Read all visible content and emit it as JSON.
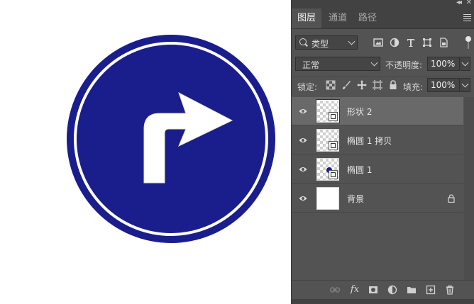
{
  "panel": {
    "tabs": [
      {
        "label": "图层",
        "active": true
      },
      {
        "label": "通道",
        "active": false
      },
      {
        "label": "路径",
        "active": false
      }
    ],
    "filter": {
      "kind_label": "类型"
    },
    "blend_mode": "正常",
    "opacity_label": "不透明度:",
    "opacity_value": "100%",
    "lock_label": "锁定:",
    "fill_label": "填充:",
    "fill_value": "100%",
    "layers": [
      {
        "name": "形状 2",
        "selected": true,
        "thumb": "transparent-shape"
      },
      {
        "name": "椭圆 1 拷贝",
        "selected": false,
        "thumb": "transparent-shape"
      },
      {
        "name": "椭圆 1",
        "selected": false,
        "thumb": "transparent-shape-dot"
      },
      {
        "name": "背景",
        "selected": false,
        "thumb": "white",
        "locked": true
      }
    ]
  },
  "canvas": {
    "sign_color": "#1a1e8c",
    "ring_color": "#ffffff",
    "arrow_color": "#ffffff"
  },
  "colors": {
    "panel_bg": "#535353",
    "tab_bar_bg": "#424242",
    "selected_row": "#696969"
  }
}
